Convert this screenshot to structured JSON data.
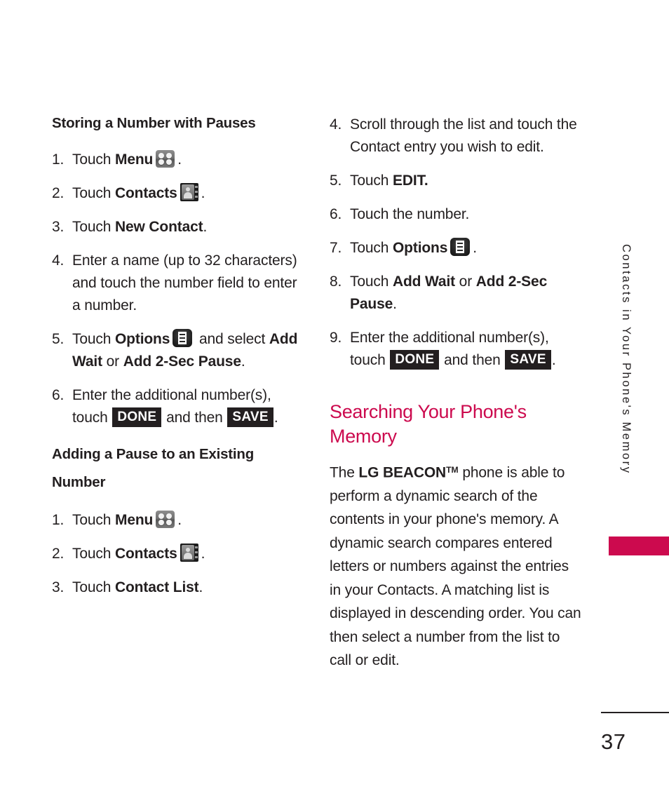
{
  "page": {
    "number": "37",
    "running_head": "Contacts in Your Phone's Memory",
    "accent_color": "#cc0a4e",
    "text_color": "#231f20"
  },
  "left_column": {
    "heading_1": "Storing a Number with Pauses",
    "steps_1": [
      {
        "num": "1.",
        "pre": "Touch ",
        "bold": "Menu",
        "icon": "menu-icon",
        "post": "."
      },
      {
        "num": "2.",
        "pre": "Touch ",
        "bold": "Contacts",
        "icon": "contacts-icon",
        "post": "."
      },
      {
        "num": "3.",
        "pre": "Touch ",
        "bold": "New Contact",
        "post": "."
      },
      {
        "num": "4.",
        "text": "Enter a name (up to 32 characters) and touch the number field to enter a number."
      },
      {
        "num": "5.",
        "pre": "Touch ",
        "bold": "Options",
        "icon": "options-icon",
        "mid": " and select ",
        "bold2": "Add Wait",
        "mid2": " or ",
        "bold3": "Add 2-Sec Pause",
        "post": "."
      },
      {
        "num": "6.",
        "pre": "Enter the additional number(s), touch ",
        "key1": "DONE",
        "mid": " and then ",
        "key2": "SAVE",
        "post": "."
      }
    ],
    "heading_2": "Adding a Pause to an Existing Number",
    "steps_2": [
      {
        "num": "1.",
        "pre": "Touch ",
        "bold": "Menu",
        "icon": "menu-icon",
        "post": "."
      },
      {
        "num": "2.",
        "pre": "Touch ",
        "bold": "Contacts",
        "icon": "contacts-icon",
        "post": "."
      },
      {
        "num": "3.",
        "pre": "Touch ",
        "bold": "Contact List",
        "post": "."
      }
    ]
  },
  "right_column": {
    "steps": [
      {
        "num": "4.",
        "text": "Scroll through the list and touch the Contact entry you wish to edit."
      },
      {
        "num": "5.",
        "pre": "Touch ",
        "bold": "EDIT."
      },
      {
        "num": "6.",
        "text": "Touch the number."
      },
      {
        "num": "7.",
        "pre": "Touch ",
        "bold": "Options",
        "icon": "options-icon",
        "post": "."
      },
      {
        "num": "8.",
        "pre": "Touch ",
        "bold": "Add Wait",
        "mid": " or ",
        "bold2": "Add 2-Sec Pause",
        "post": "."
      },
      {
        "num": "9.",
        "pre": "Enter the additional number(s), touch ",
        "key1": "DONE",
        "mid": " and then ",
        "key2": "SAVE",
        "post": "."
      }
    ],
    "section_heading": "Searching Your Phone's Memory",
    "paragraph": {
      "lead": "The ",
      "product": "LG BEACON",
      "trademark": "TM",
      "rest": " phone is able to perform a dynamic search of the contents in your phone's memory. A dynamic search compares entered letters or numbers against the entries in your Contacts. A matching list is displayed in descending order. You can then select a number from the list to call or edit."
    }
  }
}
